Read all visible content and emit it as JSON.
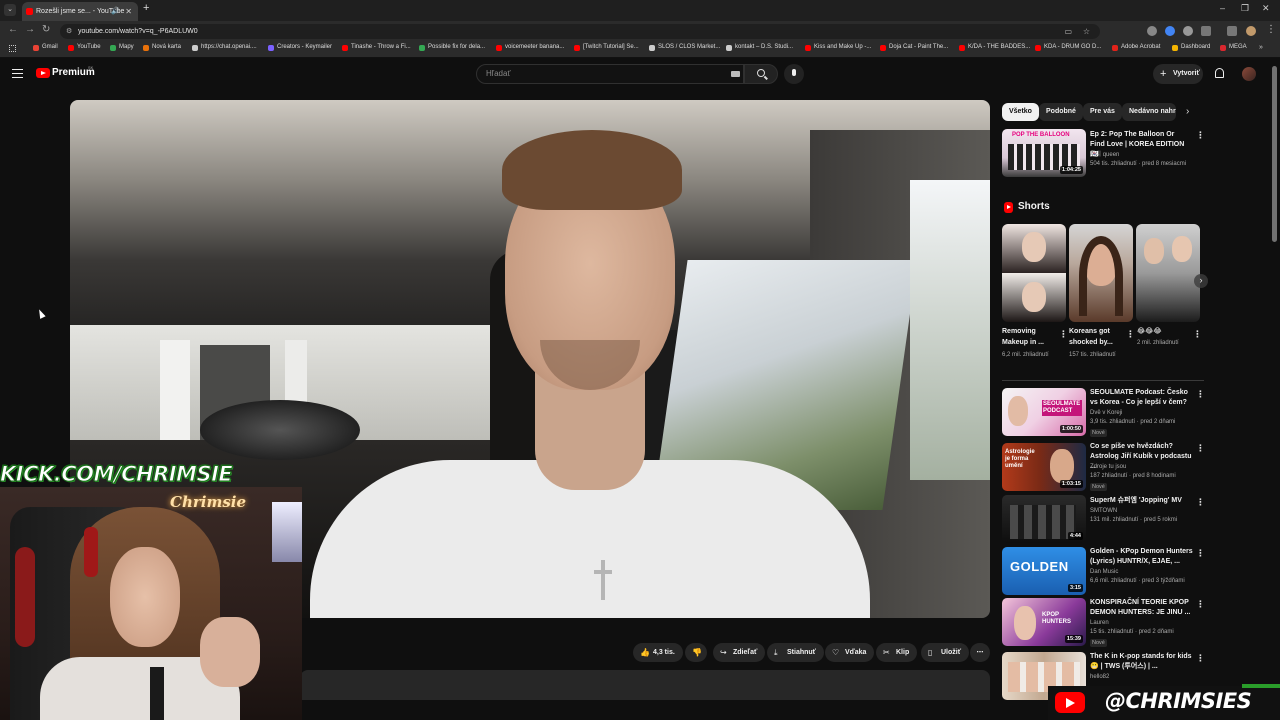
{
  "browser": {
    "tab_title": "Rozešli jsme se... - YouTube",
    "new_tab_label": "+",
    "url": "youtube.com/watch?v=q_-P6ADLUW0",
    "window_controls": {
      "minimize": "–",
      "maximize": "❐",
      "close": "✕"
    },
    "bookmarks": [
      {
        "label": "Gmail",
        "color": "#ea4335"
      },
      {
        "label": "YouTube",
        "color": "#ff0000"
      },
      {
        "label": "Mapy",
        "color": "#34a853"
      },
      {
        "label": "Nová karta",
        "color": "#e8710a"
      },
      {
        "label": "https://chat.openai....",
        "color": "#cccccc"
      },
      {
        "label": "Creators - Keymailer",
        "color": "#7b61ff"
      },
      {
        "label": "Tinashe - Throw a Fi...",
        "color": "#ff0000"
      },
      {
        "label": "Possible fix for dela...",
        "color": "#34a853"
      },
      {
        "label": "voicemeeter banana...",
        "color": "#ff0000"
      },
      {
        "label": "[Twitch Tutorial] Se...",
        "color": "#ff0000"
      },
      {
        "label": "SLOS / CLOS Market...",
        "color": "#cccccc"
      },
      {
        "label": "kontakt – D.S. Studi...",
        "color": "#cccccc"
      },
      {
        "label": "Kiss and Make Up -...",
        "color": "#ff0000"
      },
      {
        "label": "Doja Cat - Paint The...",
        "color": "#ff0000"
      },
      {
        "label": "K/DA - THE BADDES...",
        "color": "#ff0000"
      },
      {
        "label": "KDA - DRUM GO D...",
        "color": "#ff0000"
      },
      {
        "label": "Adobe Acrobat",
        "color": "#e2231a"
      },
      {
        "label": "Dashboard",
        "color": "#f4b400"
      },
      {
        "label": "MEGA",
        "color": "#d9272e"
      }
    ]
  },
  "header": {
    "logo_text": "Premium",
    "logo_sup": "SK",
    "search_placeholder": "Hľadať",
    "create_label": "Vytvoriť"
  },
  "actions": {
    "like_count": "4,3 tis.",
    "share": "Zdieľať",
    "download": "Stiahnuť",
    "thanks": "Vďaka",
    "clip": "Klip",
    "save": "Uložiť",
    "more": "⋯"
  },
  "overlay": {
    "kick_text": "KICK.COM/CHRIMSIE",
    "handle": "@CHRIMSIES"
  },
  "sidebar": {
    "chips": [
      "Všetko",
      "Podobné",
      "Pre vás",
      "Nedávno nahra"
    ],
    "top_video": {
      "title": "Ep 2: Pop The Balloon Or Find Love | KOREA EDITION🇰🇷",
      "channel": "찌니 queen",
      "meta": "504 tis. zhliadnutí · pred 8 mesiacmi",
      "duration": "1:04:25"
    },
    "shorts_label": "Shorts",
    "shorts": [
      {
        "title": "Removing Makeup in ...",
        "meta": "6,2 mil. zhliadnutí"
      },
      {
        "title": "Koreans got shocked by...",
        "meta": "157 tis. zhliadnutí"
      },
      {
        "title": "😂😂😂",
        "meta": "2 mil. zhliadnutí"
      }
    ],
    "videos": [
      {
        "title": "SEOULMATE Podcast: Česko vs Korea - Co je lepší v čem?",
        "channel": "Dvě v Koreji",
        "meta": "3,9 tis. zhliadnutí · pred 2 dňami",
        "badge": "Nové",
        "duration": "1:00:50"
      },
      {
        "title": "Co se píše ve hvězdách? Astrolog Jiří Kubík v podcastu ...",
        "channel": "Zdroje tu jsou",
        "meta": "187 zhliadnutí · pred 8 hodinami",
        "badge": "Nové",
        "duration": "1:03:15"
      },
      {
        "title": "SuperM 슈퍼엠 'Jopping' MV",
        "channel": "SMTOWN",
        "meta": "131 mil. zhliadnutí · pred 5 rokmi",
        "badge": "",
        "duration": "4:44"
      },
      {
        "title": "Golden - KPop Demon Hunters (Lyrics) HUNTR/X, EJAE, ...",
        "channel": "Dan Music",
        "meta": "6,6 mil. zhliadnutí · pred 3 týždňami",
        "badge": "",
        "duration": "3:15"
      },
      {
        "title": "KONSPIRAČNÍ TEORIE KPOP DEMON HUNTERS: JE JINU ...",
        "channel": "Lauren",
        "meta": "15 tis. zhliadnutí · pred 2 dňami",
        "badge": "Nové",
        "duration": "15:39"
      },
      {
        "title": "The K in K-pop stands for kids 😬 | TWS (투어스) | ...",
        "channel": "hello82",
        "meta": "",
        "badge": "",
        "duration": ""
      }
    ],
    "thumb_texts": {
      "pop_balloon": "POP THE BALLOON",
      "seoulmate": "SEOULMATE PODCAST",
      "astrologie": "Astrologie je forma umění",
      "golden": "GOLDEN",
      "kpop": "KPOP HUNTERS"
    }
  }
}
